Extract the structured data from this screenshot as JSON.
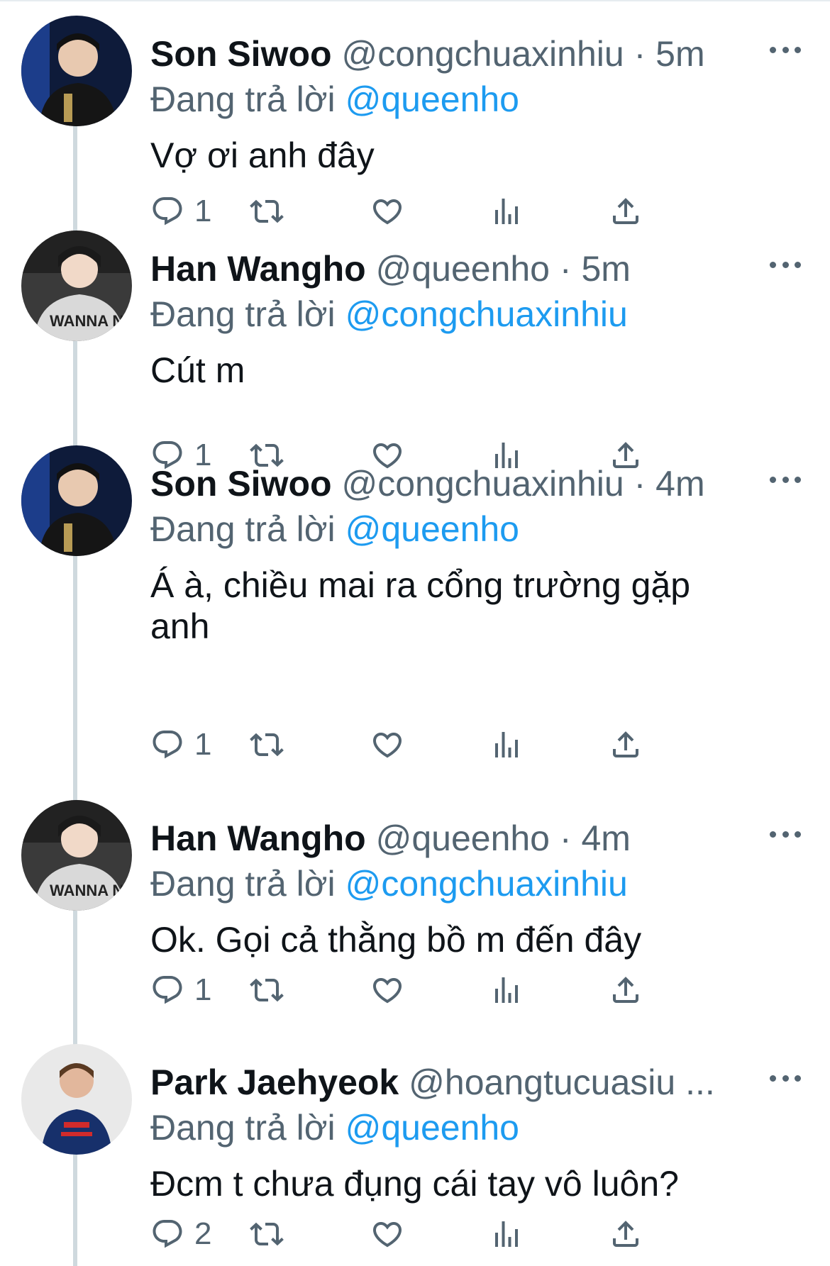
{
  "tweets": [
    {
      "name": "Son Siwoo",
      "handle": "@congchuaxinhiu",
      "time": "5m",
      "reply_prefix": "Đang trả lời",
      "reply_to": "@queenho",
      "text": "Vợ ơi anh đây",
      "reply_count": "1",
      "avatar": "avatar-son-siwoo"
    },
    {
      "name": "Han Wangho",
      "handle": "@queenho",
      "time": "5m",
      "reply_prefix": "Đang trả lời",
      "reply_to": "@congchuaxinhiu",
      "text": "Cút m",
      "reply_count": "1",
      "avatar": "avatar-han-wangho"
    },
    {
      "name": "Son Siwoo",
      "handle": "@congchuaxinhiu",
      "time": "4m",
      "reply_prefix": "Đang trả lời",
      "reply_to": "@queenho",
      "text": "Á à, chiều mai ra cổng trường gặp anh",
      "reply_count": "1",
      "avatar": "avatar-son-siwoo"
    },
    {
      "name": "Han Wangho",
      "handle": "@queenho",
      "time": "4m",
      "reply_prefix": "Đang trả lời",
      "reply_to": "@congchuaxinhiu",
      "text": "Ok. Gọi cả thằng bồ m đến đây",
      "reply_count": "1",
      "avatar": "avatar-han-wangho"
    },
    {
      "name": "Park Jaehyeok",
      "handle": "@hoangtucuasiu ...",
      "time": "",
      "reply_prefix": "Đang trả lời",
      "reply_to": "@queenho",
      "text": "Đcm t chưa đụng cái tay vô luôn?",
      "reply_count": "2",
      "avatar": "avatar-park-jaehyeok"
    }
  ],
  "avatar_text": {
    "hoodie_print": "WANNA NOT?!"
  },
  "colors": {
    "link": "#1d9bf0",
    "secondary": "#536471",
    "thread_line": "#cfd9de"
  },
  "icons": [
    "reply-icon",
    "retweet-icon",
    "like-icon",
    "views-icon",
    "share-icon",
    "more-icon"
  ]
}
